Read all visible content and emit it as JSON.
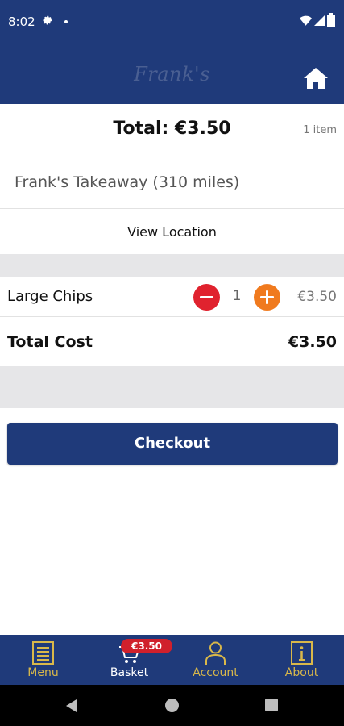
{
  "status_bar": {
    "time": "8:02",
    "icons": [
      "gear-icon",
      "notification-dot-icon",
      "wifi-icon",
      "signal-icon",
      "battery-icon"
    ]
  },
  "app_bar": {
    "logo_text": "Frank's",
    "home_icon": "home-icon",
    "background_color": "#1f3a7a"
  },
  "basket": {
    "total_title": "Total: €3.50",
    "item_count": "1 item",
    "store_name": "Frank's Takeaway (310 miles)",
    "view_location_label": "View Location",
    "items": [
      {
        "name": "Large Chips",
        "quantity": "1",
        "price": "€3.50"
      }
    ],
    "total_cost_label": "Total Cost",
    "total_cost_value": "€3.50",
    "checkout_label": "Checkout"
  },
  "tab_bar": {
    "tabs": [
      {
        "label": "Menu",
        "icon": "menu-icon",
        "active": false
      },
      {
        "label": "Basket",
        "icon": "cart-icon",
        "active": true
      },
      {
        "label": "Account",
        "icon": "user-icon",
        "active": false
      },
      {
        "label": "About",
        "icon": "info-icon",
        "active": false
      }
    ],
    "basket_badge": "€3.50",
    "accent_color": "#d9b84a"
  },
  "colors": {
    "primary": "#1f3a7a",
    "minus_button": "#e0222e",
    "plus_button": "#f07a1e",
    "badge": "#d0202c"
  },
  "system_nav": {
    "icons": [
      "back-icon",
      "home-circle-icon",
      "recents-icon"
    ]
  }
}
